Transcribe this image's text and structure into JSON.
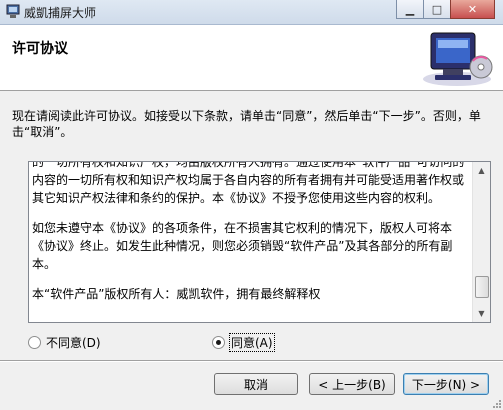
{
  "window": {
    "title": "威凱捕屏大师",
    "minimize_glyph": "▁",
    "maximize_glyph": "□",
    "close_glyph": "✕"
  },
  "header": {
    "title": "许可协议",
    "logo_icon": "computer-cd-icon"
  },
  "intro": "现在请阅读此许可协议。如接受以下条款，请单击“同意”，然后单击“下一步”。否则，单击“取消”。",
  "license": {
    "paragraphs": [
      "的一切所有权和知识产权，均由版权所有人拥有。通过使用本“软件产品”可访问的内容的一切所有权和知识产权均属于各自内容的所有者拥有并可能受适用著作权或其它知识产权法律和条约的保护。本《协议》不授予您使用这些内容的权利。",
      "如您未遵守本《协议》的各项条件，在不损害其它权利的情况下，版权人可将本《协议》终止。如发生此种情况，则您必须销毁“软件产品”及其各部分的所有副本。",
      "本“软件产品”版权所有人：威凯软件，拥有最终解释权"
    ]
  },
  "radios": {
    "disagree_label": "不同意(D)",
    "agree_label": "同意(A)",
    "selected": "agree"
  },
  "buttons": {
    "cancel": "取消",
    "back": "< 上一步(B)",
    "next": "下一步(N) >"
  },
  "colors": {
    "header_bg": "#ffffff",
    "dialog_bg": "#f0f0f0",
    "default_button_border": "#3c7fb1"
  }
}
